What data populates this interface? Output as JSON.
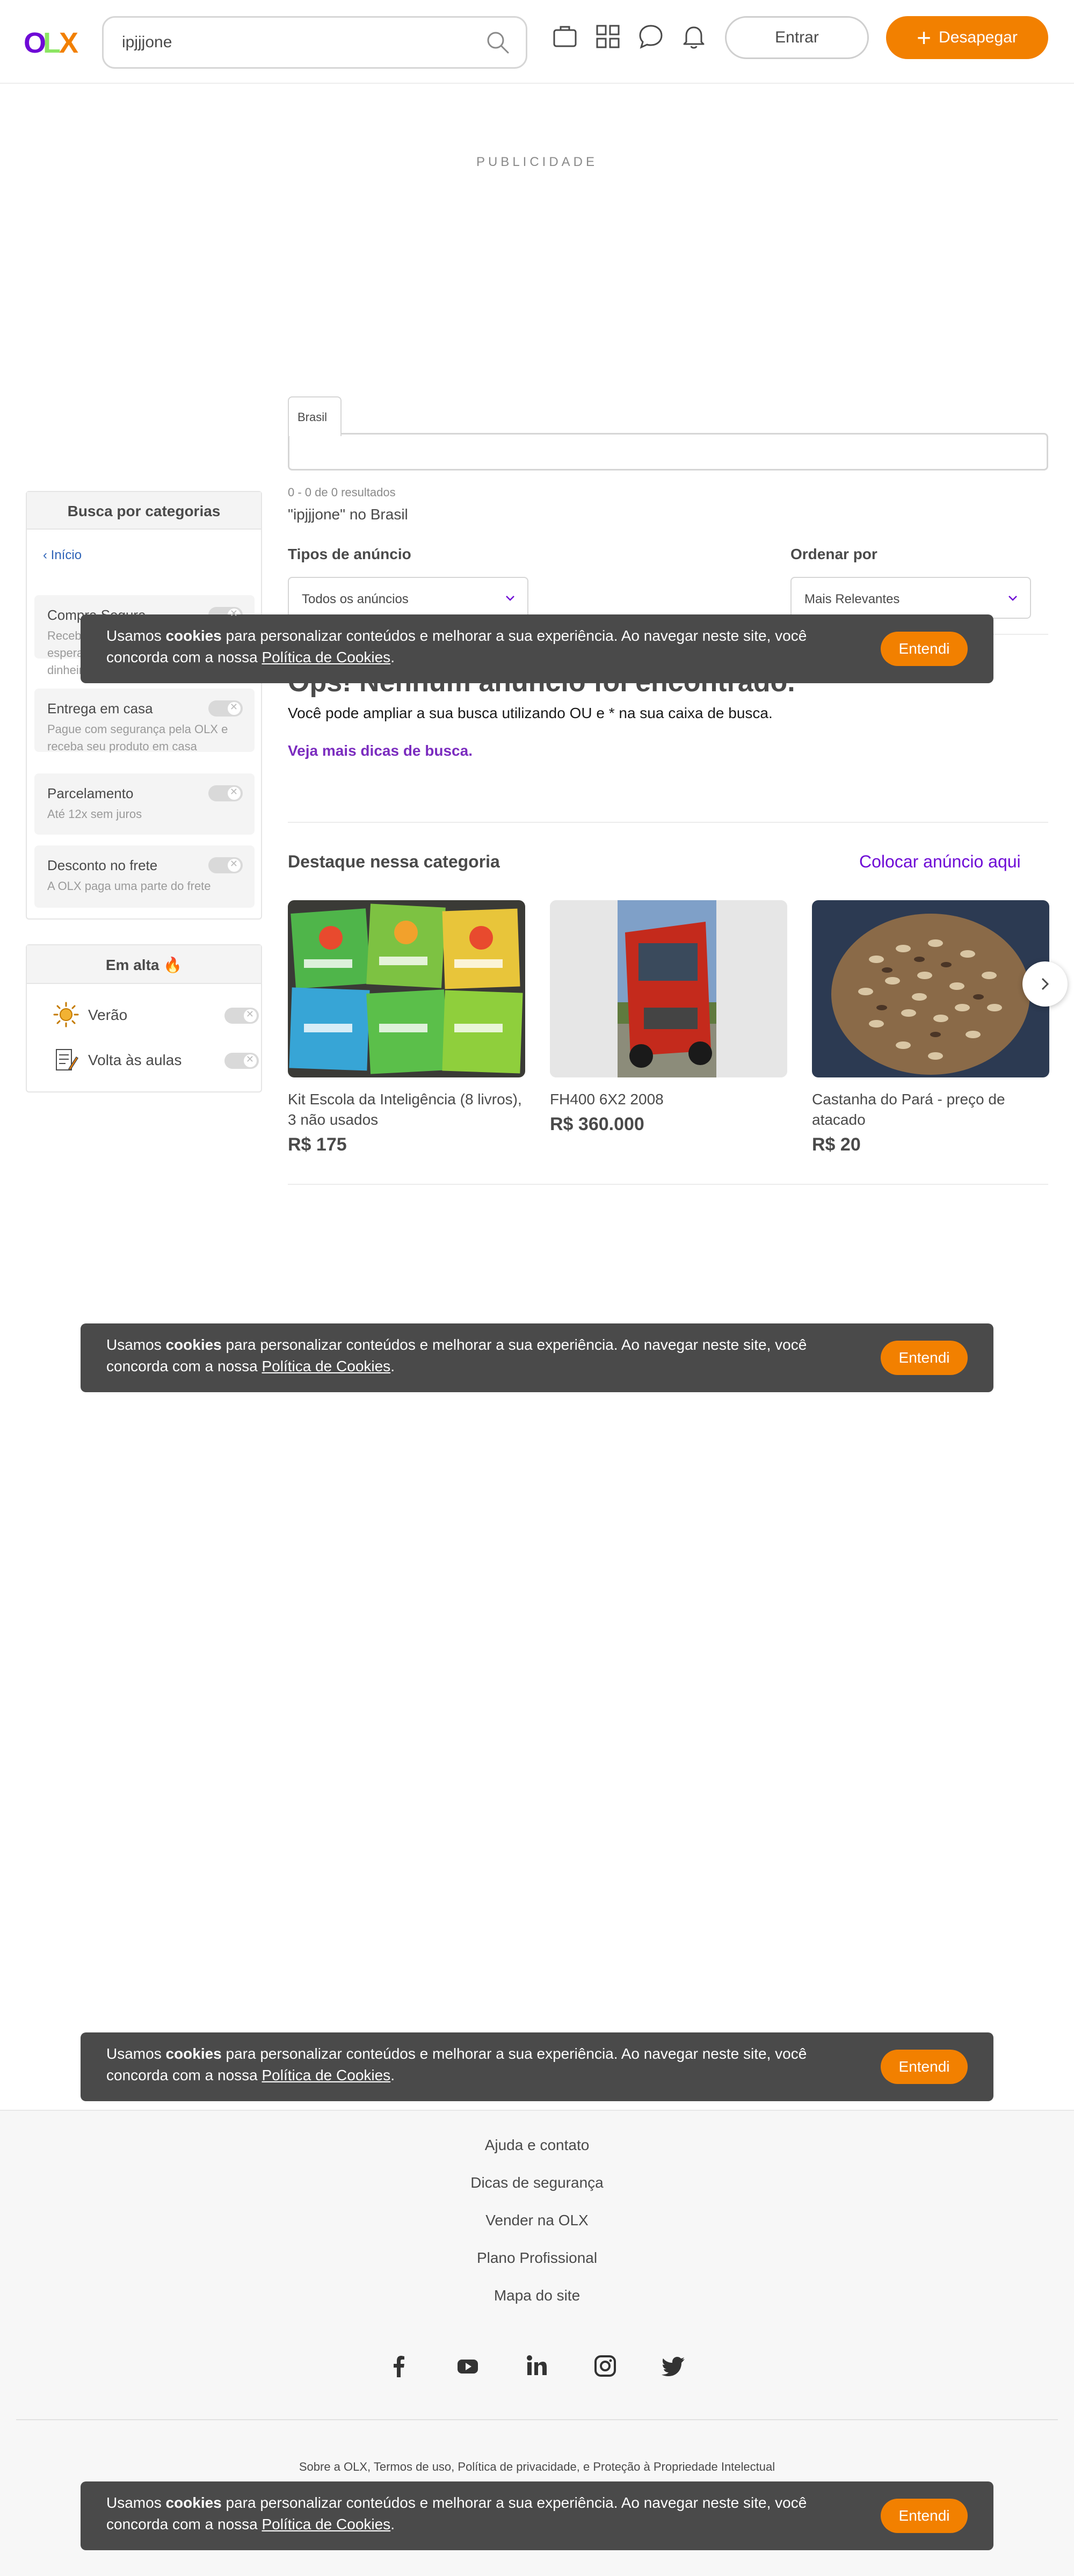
{
  "header": {
    "logo_letters": [
      "O",
      "L",
      "X"
    ],
    "search_value": "ipjjjone",
    "login_label": "Entrar",
    "sell_label": "Desapegar"
  },
  "ad": {
    "label": "PUBLICIDADE"
  },
  "location": {
    "tab_label": "Brasil"
  },
  "results": {
    "count_text": "0 - 0 de 0 resultados",
    "query_text": "\"ipjjjone\" no Brasil"
  },
  "sidebar": {
    "categories_title": "Busca por categorias",
    "home_link": "Início",
    "features": [
      {
        "title": "Compra Segura",
        "desc": "Receba o produto que está esperando ou devolvemos o dinheiro"
      },
      {
        "title": "Entrega em casa",
        "desc": "Pague com segurança pela OLX e receba seu produto em casa"
      },
      {
        "title": "Parcelamento",
        "desc": "Até 12x sem juros"
      },
      {
        "title": "Desconto no frete",
        "desc": "A OLX paga uma parte do frete"
      }
    ],
    "trending_title": "Em alta 🔥",
    "trending": [
      {
        "label": "Verão"
      },
      {
        "label": "Volta às aulas"
      }
    ]
  },
  "filters": {
    "types_label": "Tipos de anúncio",
    "types_value": "Todos os anúncios",
    "order_label": "Ordenar por",
    "order_value": "Mais Relevantes"
  },
  "empty": {
    "title": "Ops! Nenhum anúncio foi encontrado.",
    "subtitle": "Você pode ampliar a sua busca utilizando OU e * na sua caixa de busca.",
    "tips_link": "Veja mais dicas de busca."
  },
  "featured": {
    "title": "Destaque nessa categoria",
    "cta": "Colocar anúncio aqui",
    "items": [
      {
        "name": "Kit Escola da Inteligência (8 livros), 3 não usados",
        "price": "R$ 175"
      },
      {
        "name": "FH400 6X2 2008",
        "price": "R$ 360.000"
      },
      {
        "name": "Castanha do Pará - preço de atacado",
        "price": "R$ 20"
      }
    ]
  },
  "cookie": {
    "text_before": "Usamos ",
    "text_bold": "cookies",
    "text_middle": " para personalizar conteúdos e melhorar a sua experiência. Ao navegar neste site, você concorda com a nossa ",
    "text_link": "Política de Cookies",
    "text_after": ".",
    "button": "Entendi"
  },
  "footer": {
    "links": [
      "Ajuda e contato",
      "Dicas de segurança",
      "Vender na OLX",
      "Plano Profissional",
      "Mapa do site"
    ],
    "social_icons": [
      "facebook-icon",
      "youtube-icon",
      "linkedin-icon",
      "instagram-icon",
      "twitter-icon"
    ],
    "legal": {
      "about": "Sobre a OLX",
      "terms": "Termos de uso",
      "privacy": "Política de privacidade",
      "ip": "Proteção à Propriedade Intelectual",
      "sep": ", ",
      "and": ", e "
    }
  },
  "colors": {
    "brand_purple": "#6e0ad6",
    "brand_orange": "#f28000",
    "brand_green": "#8ce563",
    "cookie_bg": "#4a4a4a"
  }
}
